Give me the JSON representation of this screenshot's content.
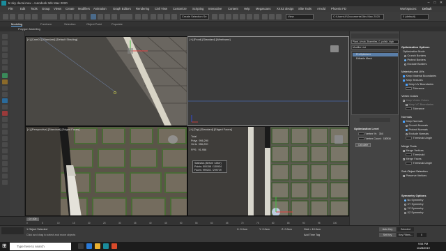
{
  "window": {
    "title": "tr-sky decal.max - Autodesk 3ds Max 2020",
    "controls": [
      "–",
      "□",
      "✕"
    ]
  },
  "menu": [
    "File",
    "Edit",
    "Tools",
    "Group",
    "Views",
    "Create",
    "Modifiers",
    "Animation",
    "Graph Editors",
    "Rendering",
    "Civil View",
    "Customize",
    "Scripting",
    "Interactive",
    "Content",
    "Help",
    "Megascans",
    "XXXZ design",
    "Slite Tools",
    "Arnold",
    "Phoenix FD"
  ],
  "toolbar": {
    "selection_set": "Create Selection Se",
    "workspace_label": "Workspaces:",
    "workspace": "Default",
    "path": "C:\\Users\\X\\Documents\\3ds Max 2020",
    "layer": "0 (default)",
    "view": "View"
  },
  "ribbon": {
    "tabs": [
      "Modeling",
      "Freeform",
      "Selection",
      "Object Paint",
      "Populate"
    ],
    "active_tab": "Modeling",
    "subtab": "Polygon Modeling"
  },
  "viewports": {
    "top_left": "[+] [Cam01] [Standard] [Default Shading]",
    "top_right": "[+] [Front] [Standard] [Wireframe]",
    "bottom_left": "[+] [Perspective] [Standard] [Edged Faces]",
    "bottom_right": "[+] [Top] [Standard] [Edged Faces]",
    "stats": {
      "total_label": "Total",
      "total_value": "956,290",
      "polys_label": "Polys",
      "polys_value": "956,290",
      "verts_label": "Verts",
      "verts_value": "956,290",
      "fps_label": "FPS:",
      "fps_value": "91.956"
    },
    "stats_popup": {
      "title": "Statistics (Before / After)",
      "points": "Points: 500158 / 130934",
      "faces": "Faces: 999202 / 299729"
    }
  },
  "command_panel": {
    "object_name": "Plant_shrub_Brambles_0_polish_high",
    "modifier_list": "Modifier List",
    "stack": [
      "ProOptimizer",
      "Editable Mesh"
    ],
    "optimization_level_title": "Optimization Level",
    "vertex_percent_label": "Vertex %:",
    "vertex_percent_value": "30.0",
    "vertex_count_label": "Vertex Count:",
    "vertex_count_value": "130934",
    "calculate_label": "Calculate"
  },
  "rollout": {
    "optimization_options": {
      "title": "Optimization Options",
      "mode_label": "Optimization Mode",
      "modes": [
        "Crunch Borders",
        "Protect Borders",
        "Exclude Borders"
      ],
      "selected_mode": 1
    },
    "materials_uvs": {
      "title": "Materials and UVs",
      "keep_material_boundaries": "Keep Material Boundaries",
      "keep_textures": "Keep Textures",
      "keep_uv_boundaries": "Keep UV Boundaries",
      "tolerance_label": "Tolerance"
    },
    "vertex_colors": {
      "title": "Vertex Colors",
      "keep_vertex_colors": "Keep Vertex Colors",
      "keep_vc_boundaries": "Keep VC Boundaries",
      "tolerance_label": "Tolerance"
    },
    "normals": {
      "title": "Normals",
      "keep_normals": "Keep Normals",
      "modes": [
        "Crunch Normals",
        "Protect Normals",
        "Exclude Normals"
      ],
      "selected_mode": 1,
      "threshold_label": "Threshold Angle"
    },
    "merge_tools": {
      "title": "Merge Tools",
      "merge_vertices": "Merge Vertices",
      "threshold_label": "Threshold",
      "merge_faces": "Merge Faces",
      "threshold_angle_label": "Threshold Angle"
    },
    "sub_object_selection": {
      "title": "Sub-Object Selection",
      "preserve_vertices": "Preserve Vertices"
    },
    "symmetry_options": {
      "title": "Symmetry Options",
      "modes": [
        "No Symmetry",
        "XY Symmetry",
        "YZ Symmetry",
        "XZ Symmetry"
      ],
      "selected_mode": 0
    }
  },
  "timeline": {
    "frame": "0 / 100",
    "ticks": [
      "0",
      "5",
      "10",
      "15",
      "20",
      "25",
      "30",
      "35",
      "40",
      "45",
      "50",
      "55",
      "60",
      "65",
      "70",
      "75",
      "80",
      "85",
      "90",
      "95",
      "100"
    ]
  },
  "status": {
    "selection": "1 Object Selected",
    "prompt": "Click and drag to select and move objects",
    "x_label": "X:",
    "x": "0.0cm",
    "y_label": "Y:",
    "y": "0.0cm",
    "z_label": "Z:",
    "z": "0.0cm",
    "grid": "Grid = 10.0cm",
    "add_time_tag": "Add Time Tag",
    "auto_key": "Auto Key",
    "selected": "Selected",
    "set_key": "Set Key",
    "key_filters": "Key Filters...",
    "frame": "0"
  },
  "taskbar": {
    "search_placeholder": "Type here to search",
    "time": "9:54 PM",
    "date": "11/28/2019"
  }
}
